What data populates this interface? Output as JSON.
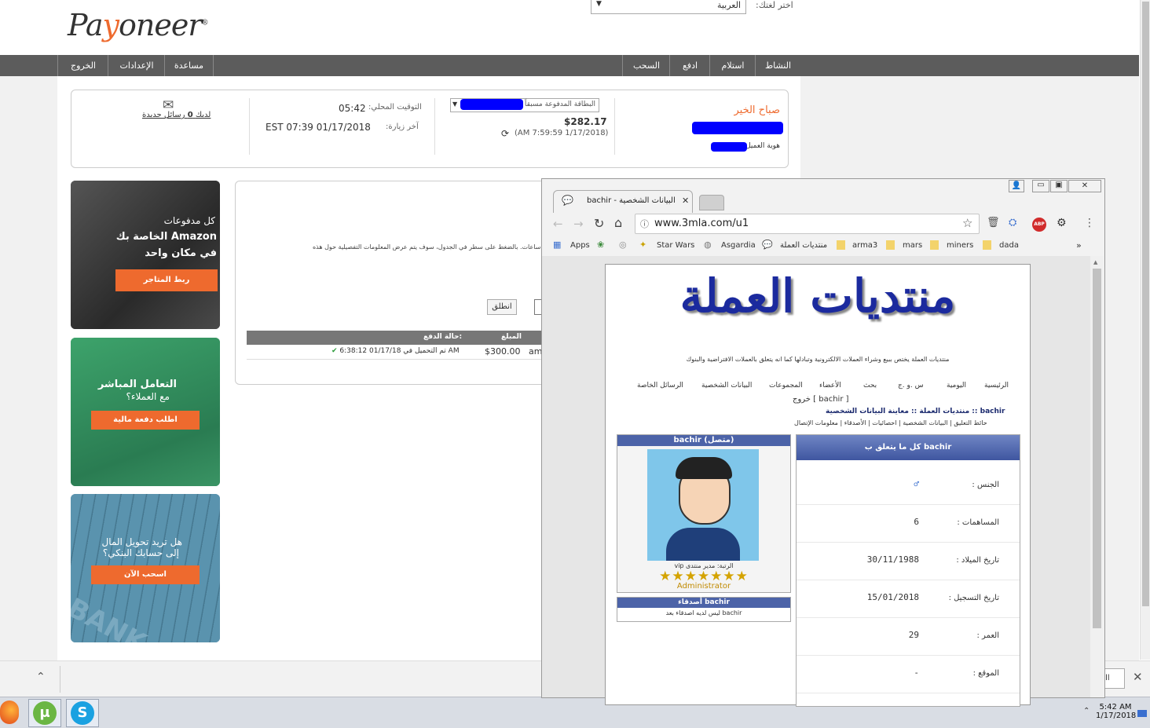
{
  "page": {
    "logo_text_1": "Pa",
    "logo_text_2": "y",
    "logo_text_3": "oneer",
    "lang_label": "اختر لغتك:",
    "lang_value": "العربية",
    "nav_right": [
      "النشاط",
      "استلام",
      "ادفع",
      "السحب"
    ],
    "nav_left": [
      "مساعدة",
      "الإعدادات",
      "الخروج"
    ],
    "greeting": "صباح الخير",
    "customer_id_label": "هوية العميل",
    "prepaid_card_label": "البطاقة المدفوعة مسبقاً",
    "balance": "$282.17",
    "balance_time": "(AM 7:59:59 1/17/2018)",
    "local_time_label": "التوقيت المحلي:",
    "local_time": "05:42",
    "last_visit_label": "آخر زيارة:",
    "last_visit": "EST 07:39 01/17/2018",
    "messages_text_pre": "لديك",
    "messages_count": "0",
    "messages_text_post": "رسائل جديدة",
    "cards": [
      {
        "line1": "كل مدفوعات",
        "line2": "Amazon الخاصة بك",
        "line3": "في مكان واحد",
        "button": "ربط المتاجر",
        "bg": "#3b3b3b"
      },
      {
        "line1": "التعامل المباشر",
        "line2": "مع العملاء؟",
        "button": "اطلب دفعة مالية",
        "bg": "#2f8a5a"
      },
      {
        "line1": "هل تريد تحويل المال",
        "line2": "إلى حسابك البنكي؟",
        "button": "اسحب الآن",
        "bg": "#4f87a3",
        "watermark": "BANK"
      }
    ],
    "content_text": "ت كل ست ساعات. بالضغط على سطر في الجدول، سوف يتم عرض المعلومات التفصيلية حول هذه",
    "go_button": "انطلق",
    "table_headers": [
      "حالة الدفع:",
      "المبلغ",
      ""
    ],
    "table_row": {
      "status": "تم التحميل في 01/17/18 6:38:12 AM",
      "amount": "$300.00",
      "extra": "am"
    }
  },
  "chrome": {
    "tab_title": "bachir - البيانات الشخصية",
    "url": "www.3mla.com/u1",
    "bookmarks": [
      "Apps",
      "Star Wars",
      "Asgardia",
      "منتديات العملة",
      "arma3",
      "mars",
      "miners",
      "dada"
    ]
  },
  "forum": {
    "title": "منتديات العملة",
    "subtitle": "منتديات العملة يختص ببيع وشراء العملات الالكترونية وتبادلها كما انه يتعلق بالعملات الافتراضية والبنوك",
    "nav": [
      "الرئيسية",
      "اليومية",
      "س .و .ج",
      "بحث",
      "الأعضاء",
      "المجموعات",
      "البيانات الشخصية",
      "الرسائل الخاصة"
    ],
    "logout": "خروج [ bachir ]",
    "breadcrumb": "منتديات العملة :: معاينة البيانات الشخصية :: bachir",
    "sublinks": "حائط التعليق | البيانات الشخصية | احصائيات | الأصدقاء | معلومات الإتصال",
    "profile_header": "bachir (متصل)",
    "rank": "الرتبة: مدير منتدى vip",
    "stars": "★★★★★★★",
    "role": "Administrator",
    "friends_header": "أصدقاء bachir",
    "friends_text": "bachir ليس لديه اصدقاء بعد",
    "about_header": "كل ما يتعلق ب bachir",
    "fields": [
      {
        "label": "الجنس :",
        "value": "♂"
      },
      {
        "label": "المساهمات :",
        "value": "6"
      },
      {
        "label": "تاريخ الميلاد :",
        "value": "30/11/1988"
      },
      {
        "label": "تاريخ التسجيل :",
        "value": "15/01/2018"
      },
      {
        "label": "العمر :",
        "value": "29"
      },
      {
        "label": "الموقع :",
        "value": "-"
      }
    ]
  },
  "bottom_bar": {
    "partial_button": "all"
  },
  "taskbar": {
    "time": "5:42 AM",
    "date": "1/17/2018"
  }
}
